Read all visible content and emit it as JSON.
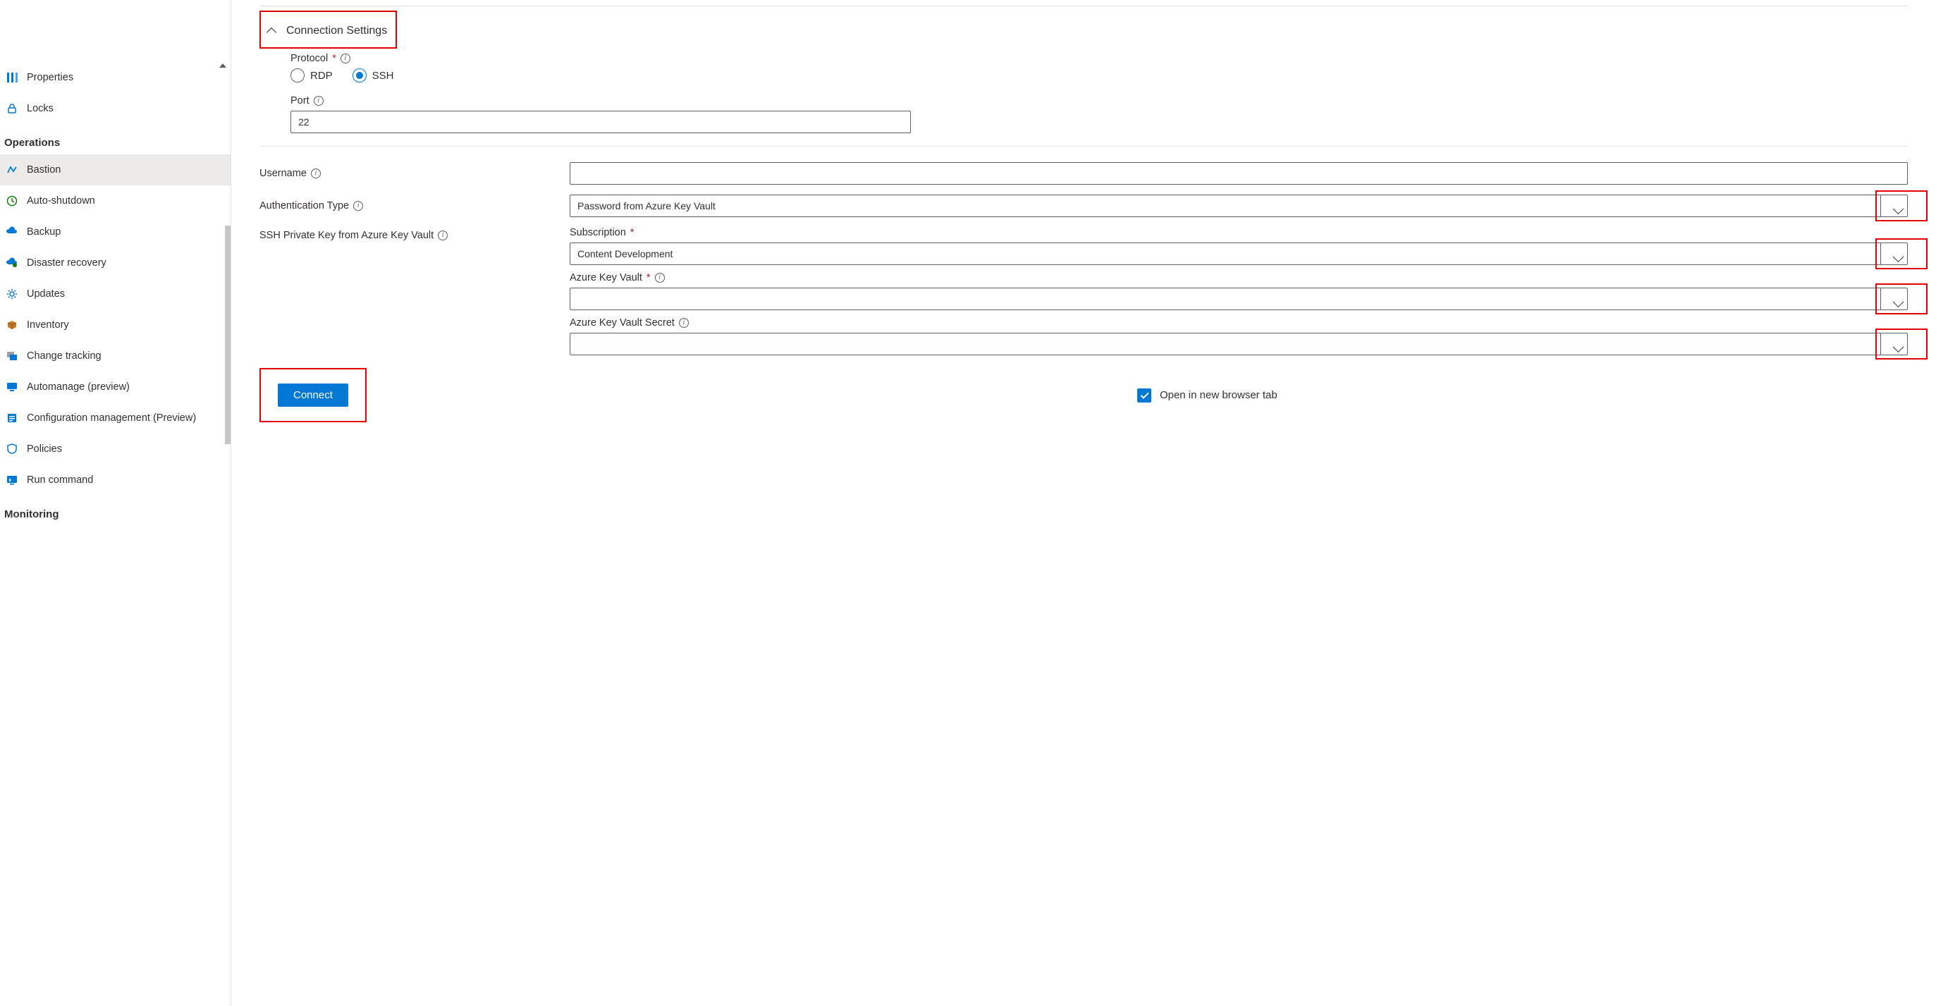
{
  "sidebar": {
    "items": [
      {
        "label": "Properties",
        "icon": "properties-icon"
      },
      {
        "label": "Locks",
        "icon": "lock-icon"
      }
    ],
    "section_operations": "Operations",
    "ops_items": [
      {
        "label": "Bastion",
        "icon": "bastion-icon",
        "selected": true
      },
      {
        "label": "Auto-shutdown",
        "icon": "clock-icon"
      },
      {
        "label": "Backup",
        "icon": "backup-icon"
      },
      {
        "label": "Disaster recovery",
        "icon": "disaster-icon"
      },
      {
        "label": "Updates",
        "icon": "gear-icon"
      },
      {
        "label": "Inventory",
        "icon": "box-icon"
      },
      {
        "label": "Change tracking",
        "icon": "change-icon"
      },
      {
        "label": "Automanage (preview)",
        "icon": "monitor-icon"
      },
      {
        "label": "Configuration management (Preview)",
        "icon": "config-icon"
      },
      {
        "label": "Policies",
        "icon": "policy-icon"
      },
      {
        "label": "Run command",
        "icon": "run-icon"
      }
    ],
    "section_monitoring": "Monitoring"
  },
  "expander_title": "Connection Settings",
  "protocol": {
    "label": "Protocol",
    "options": {
      "rdp": "RDP",
      "ssh": "SSH"
    },
    "selected": "ssh"
  },
  "port": {
    "label": "Port",
    "value": "22"
  },
  "username_label": "Username",
  "auth_type": {
    "label": "Authentication Type",
    "value": "Password from Azure Key Vault"
  },
  "ssh_kv_label": "SSH Private Key from Azure Key Vault",
  "subscription": {
    "label": "Subscription",
    "value": "Content Development"
  },
  "kv": {
    "label": "Azure Key Vault",
    "value": ""
  },
  "kv_secret": {
    "label": "Azure Key Vault Secret",
    "value": ""
  },
  "connect_label": "Connect",
  "open_new_tab_label": "Open in new browser tab",
  "open_new_tab_checked": true
}
